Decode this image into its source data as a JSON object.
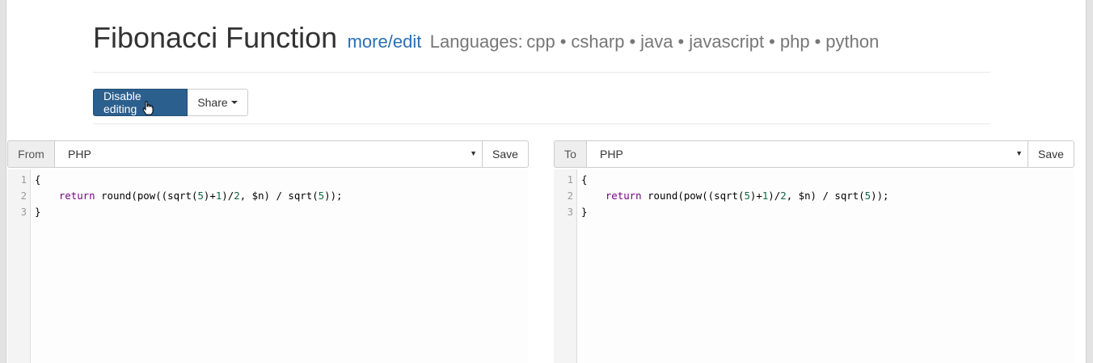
{
  "header": {
    "title": "Fibonacci Function",
    "more_link": "more/edit",
    "languages_prefix": "Languages:",
    "languages": [
      "cpp",
      "csharp",
      "java",
      "javascript",
      "php",
      "python"
    ],
    "separator": "•"
  },
  "toolbar": {
    "disable_label": "Disable editing",
    "share_label": "Share"
  },
  "left_panel": {
    "addon_label": "From",
    "language": "PHP",
    "save_label": "Save"
  },
  "right_panel": {
    "addon_label": "To",
    "language": "PHP",
    "save_label": "Save"
  },
  "code": {
    "line_numbers": [
      "1",
      "2",
      "3"
    ],
    "line1": "{",
    "indent": "    ",
    "kw_return": "return",
    "fn_round": " round(pow((sqrt(",
    "n5a": "5",
    "op_plus": ")+",
    "n1": "1",
    "op_div": ")/",
    "n2": "2",
    "mid": ", $n) / sqrt(",
    "n5b": "5",
    "end": "));",
    "line3": "}"
  },
  "colors": {
    "primary_button": "#2b5f8e",
    "link": "#2a6fb5",
    "keyword": "#770088",
    "number": "#116644"
  }
}
